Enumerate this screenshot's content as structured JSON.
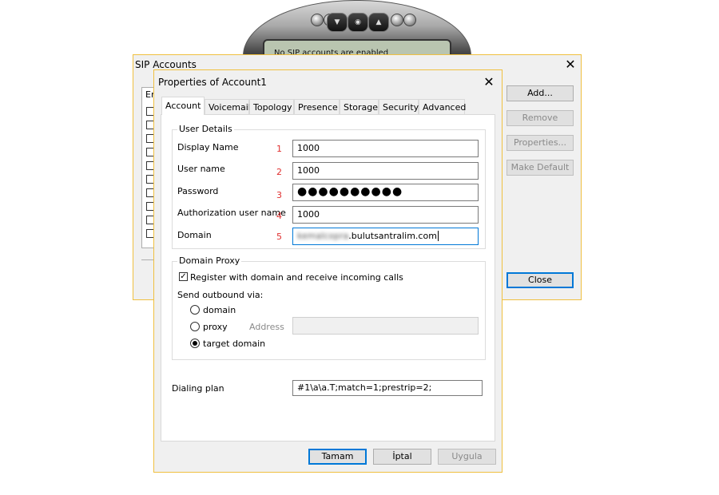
{
  "phone": {
    "status_text": "No SIP accounts are enabled"
  },
  "sip_accounts": {
    "title": "SIP Accounts",
    "column_header_fragment": "En",
    "buttons": {
      "add": "Add...",
      "remove": "Remove",
      "properties": "Properties...",
      "make_default": "Make Default",
      "close": "Close"
    }
  },
  "properties": {
    "title": "Properties of Account1",
    "tabs": [
      "Account",
      "Voicemail",
      "Topology",
      "Presence",
      "Storage",
      "Security",
      "Advanced"
    ],
    "active_tab": "Account",
    "user_details": {
      "legend": "User Details",
      "fields": [
        {
          "label": "Display Name",
          "num": "1",
          "value": "1000"
        },
        {
          "label": "User name",
          "num": "2",
          "value": "1000"
        },
        {
          "label": "Password",
          "num": "3",
          "value": "●●●●●●●●●●"
        },
        {
          "label": "Authorization user name",
          "num": "4",
          "value": "1000"
        },
        {
          "label": "Domain",
          "num": "5",
          "value_blurred": "kemalcopra",
          "value": ".bulutsantralim.com"
        }
      ]
    },
    "domain_proxy": {
      "legend": "Domain Proxy",
      "register_label": "Register with domain and receive incoming calls",
      "register_checked": true,
      "send_outbound_label": "Send outbound via:",
      "options": [
        "domain",
        "proxy",
        "target domain"
      ],
      "selected_option": "target domain",
      "address_label": "Address",
      "address_value": ""
    },
    "dialing_plan": {
      "label": "Dialing plan",
      "value": "#1\\a\\a.T;match=1;prestrip=2;"
    },
    "buttons": {
      "ok": "Tamam",
      "cancel": "İptal",
      "apply": "Uygula"
    }
  }
}
